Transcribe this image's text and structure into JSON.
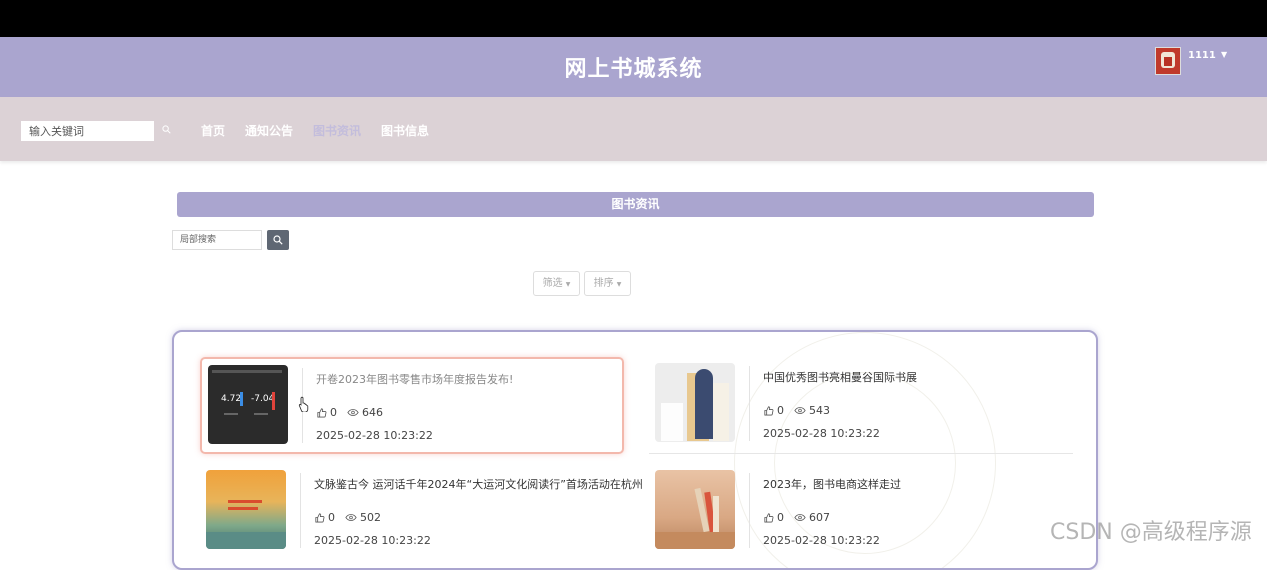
{
  "header": {
    "title": "网上书城系统",
    "username": "1111"
  },
  "nav": {
    "search_placeholder": "输入关键词",
    "items": [
      {
        "label": "首页"
      },
      {
        "label": "通知公告"
      },
      {
        "label": "图书资讯"
      },
      {
        "label": "图书信息"
      }
    ],
    "active": "图书资讯"
  },
  "section": {
    "title": "图书资讯",
    "local_search_placeholder": "局部搜索",
    "filter_label": "筛选",
    "sort_label": "排序"
  },
  "news": [
    {
      "title": "开卷2023年图书零售市场年度报告发布!",
      "likes": "0",
      "views": "646",
      "time": "2025-02-28 10:23:22",
      "thumb_text_1": "4.72",
      "thumb_text_2": "-7.04"
    },
    {
      "title": "中国优秀图书亮相曼谷国际书展",
      "likes": "0",
      "views": "543",
      "time": "2025-02-28 10:23:22"
    },
    {
      "title": "文脉鉴古今 运河话千年2024年“大运河文化阅读行”首场活动在杭州",
      "likes": "0",
      "views": "502",
      "time": "2025-02-28 10:23:22"
    },
    {
      "title": "2023年，图书电商这样走过",
      "likes": "0",
      "views": "607",
      "time": "2025-02-28 10:23:22"
    }
  ],
  "watermark": "CSDN @高级程序源"
}
